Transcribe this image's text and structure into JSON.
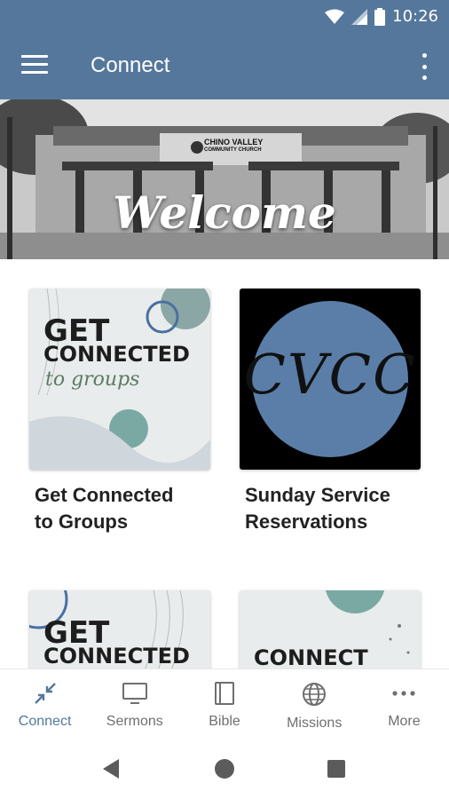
{
  "status": {
    "time": "10:26",
    "icons": [
      "wifi-icon",
      "signal-icon",
      "battery-icon"
    ]
  },
  "appbar": {
    "title": "Connect",
    "menu_icon": "menu-icon",
    "overflow_icon": "more-vert-icon",
    "color": "#55779b"
  },
  "hero": {
    "title": "Welcome",
    "sign_line1": "CHINO VALLEY",
    "sign_line2": "COMMUNITY CHURCH"
  },
  "cards": [
    {
      "title_line1": "Get Connected",
      "title_line2": "to Groups",
      "thumb_line1": "GET",
      "thumb_line2": "CONNECTED",
      "thumb_line3": "to groups"
    },
    {
      "title_line1": "Sunday Service",
      "title_line2": "Reservations",
      "thumb_text": "CVCC"
    },
    {
      "thumb_line1": "GET",
      "thumb_line2": "CONNECTED"
    },
    {
      "thumb_line1": "CONNECT"
    }
  ],
  "bottom_nav": {
    "items": [
      {
        "label": "Connect",
        "icon": "compress-arrows-icon",
        "active": true
      },
      {
        "label": "Sermons",
        "icon": "monitor-icon"
      },
      {
        "label": "Bible",
        "icon": "book-icon"
      },
      {
        "label": "Missions",
        "icon": "globe-icon"
      },
      {
        "label": "More",
        "icon": "more-horiz-icon"
      }
    ]
  },
  "system_nav": {
    "icons": [
      "back-icon",
      "home-icon",
      "recents-icon"
    ]
  }
}
